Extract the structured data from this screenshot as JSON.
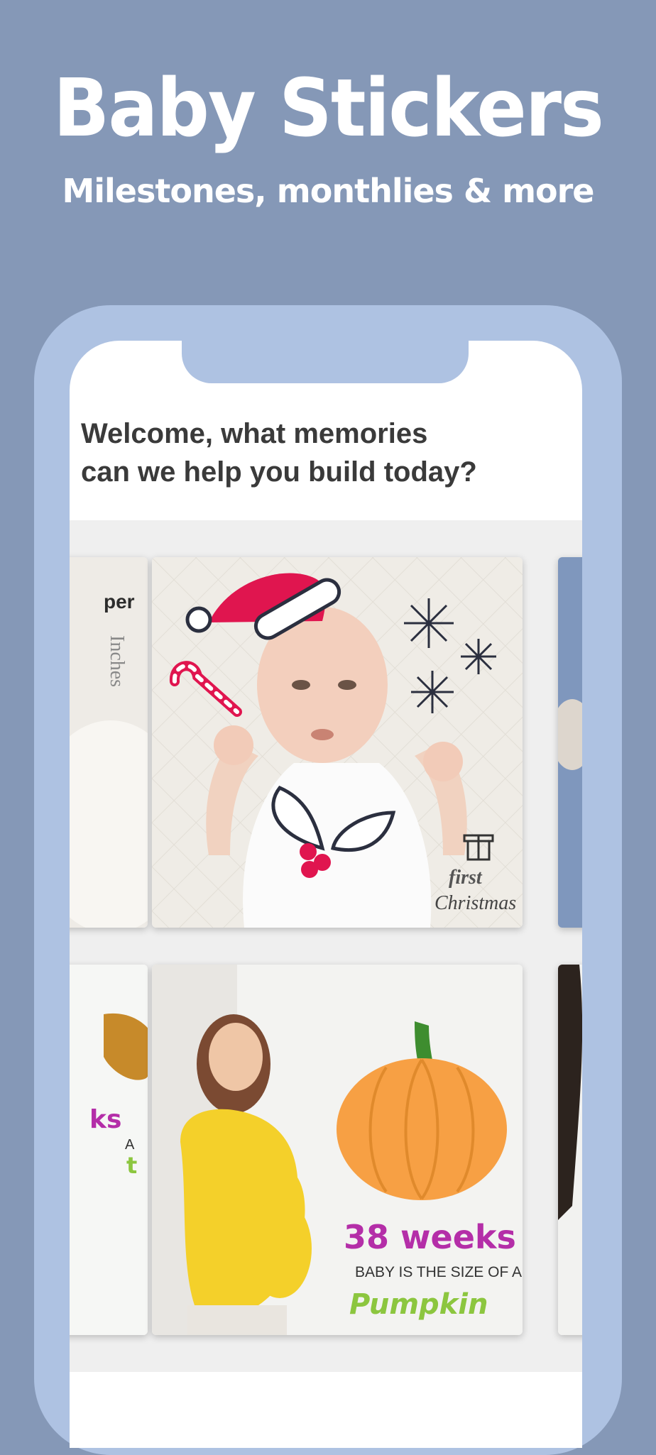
{
  "header": {
    "title": "Baby Stickers",
    "subtitle": "Milestones, monthlies & more"
  },
  "app": {
    "welcome_line1": "Welcome, what memories",
    "welcome_line2": "can we help you build today?"
  },
  "gallery": {
    "row1": {
      "left_card": {
        "text_a": "per",
        "text_b": "Inches"
      },
      "center_card": {
        "text_first": "first",
        "text_christmas": "Christmas"
      }
    },
    "row2": {
      "left_card": {
        "text_a": "ks",
        "text_b": "A",
        "text_c": "t"
      },
      "center_card": {
        "weeks": "38 weeks",
        "size_line": "BABY IS THE SIZE OF A",
        "fruit": "Pumpkin"
      }
    }
  },
  "colors": {
    "background": "#8598b7",
    "phone_frame": "#aec2e2",
    "welcome_text": "#3a3a3a",
    "santa_hat": "#e0154f",
    "pumpkin": "#f7a044",
    "weeks_text": "#b42ea8",
    "fruit_text": "#8cc63f"
  }
}
